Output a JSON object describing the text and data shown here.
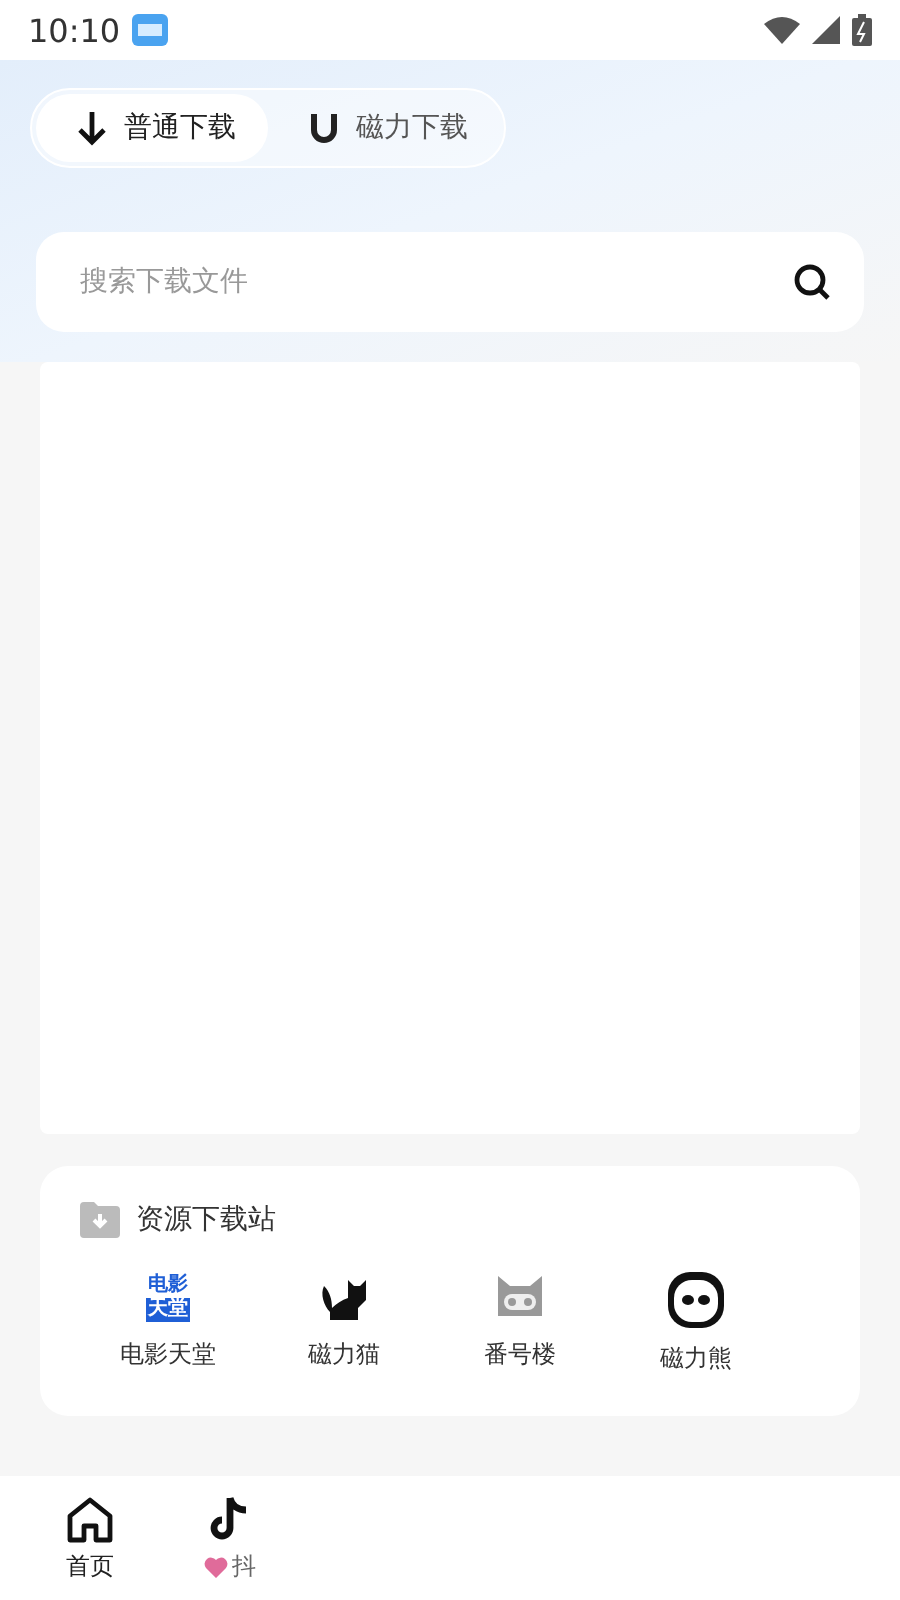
{
  "status_bar": {
    "time": "10:10"
  },
  "tabs": [
    {
      "label": "普通下载",
      "kind": "download",
      "selected": true
    },
    {
      "label": "磁力下载",
      "kind": "magnet",
      "selected": false
    }
  ],
  "search": {
    "placeholder": "搜索下载文件"
  },
  "resource_section": {
    "title": "资源下载站",
    "sites": [
      {
        "name": "电影天堂",
        "kind": "badge",
        "logo_lines": [
          "电影",
          "天堂"
        ]
      },
      {
        "name": "磁力猫",
        "kind": "cat"
      },
      {
        "name": "番号楼",
        "kind": "robot"
      },
      {
        "name": "磁力熊",
        "kind": "panda"
      }
    ]
  },
  "bottom_nav": [
    {
      "label": "首页",
      "kind": "home",
      "selected": true
    },
    {
      "label": "抖",
      "kind": "tiktok",
      "selected": false
    }
  ]
}
